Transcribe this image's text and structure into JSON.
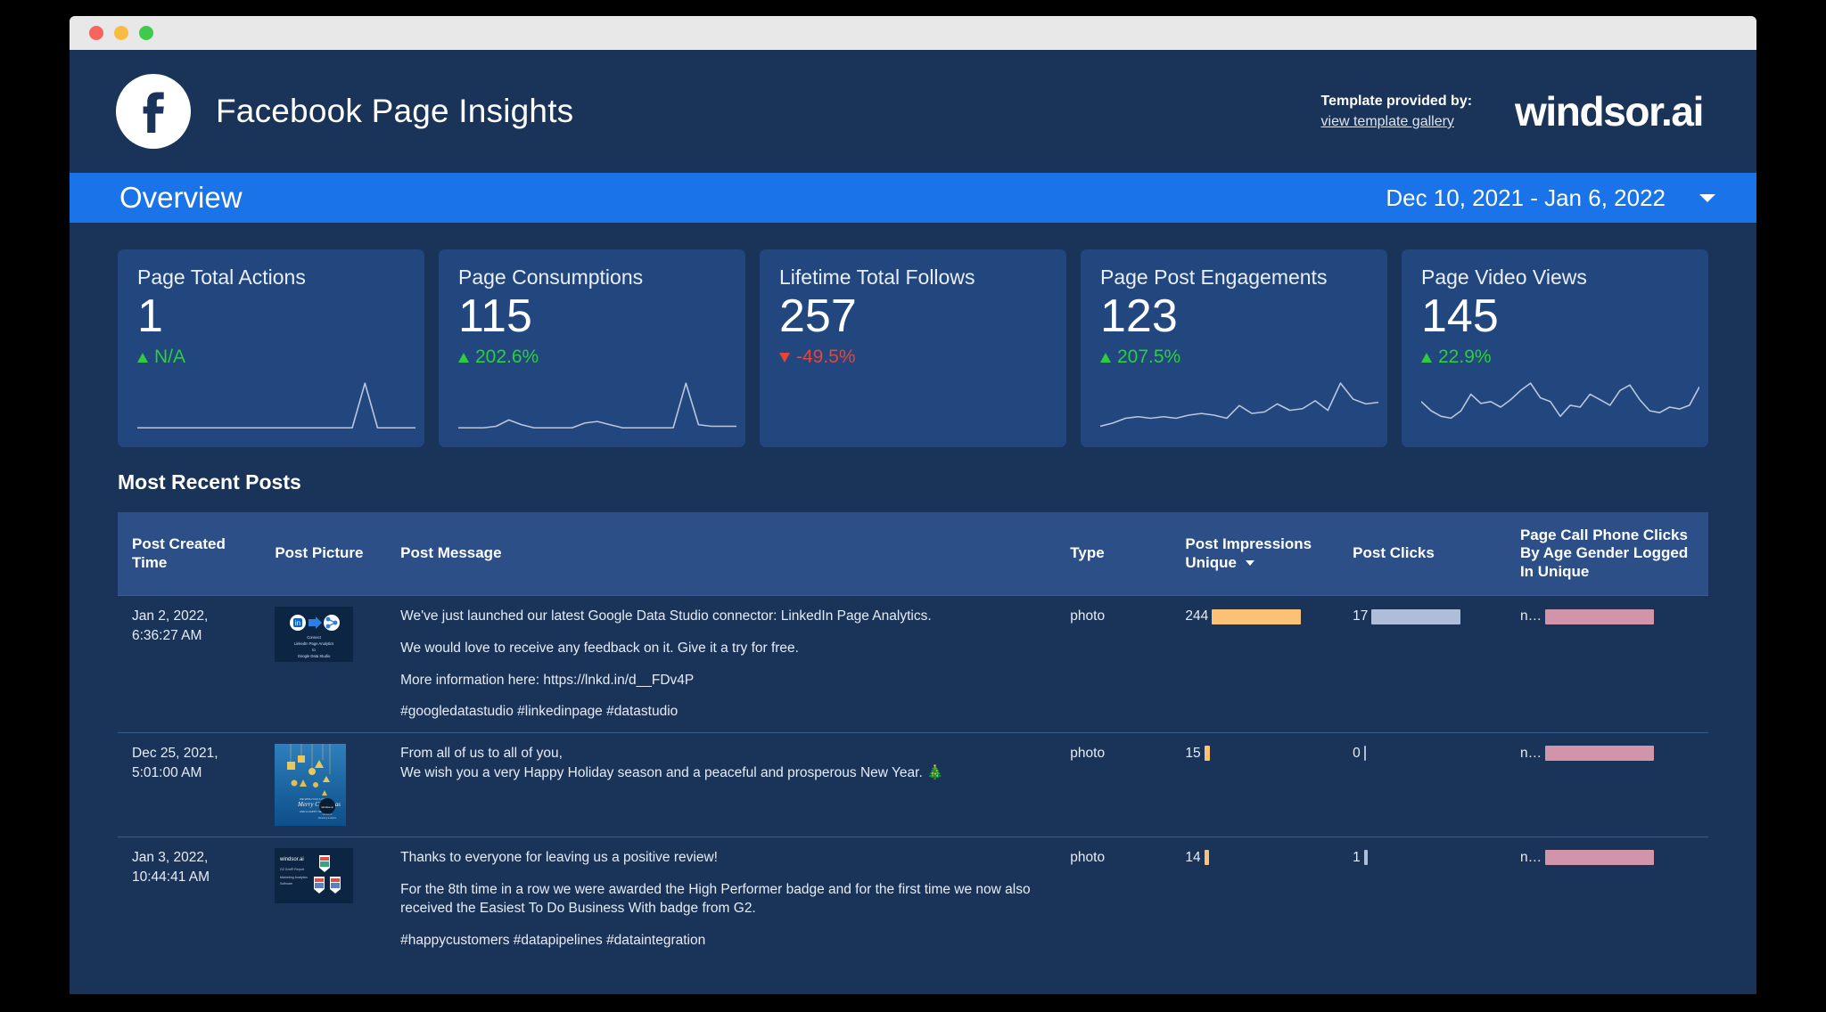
{
  "window": {
    "traffic_lights": [
      "close",
      "minimize",
      "maximize"
    ]
  },
  "header": {
    "logo_icon": "facebook-icon",
    "title": "Facebook Page Insights",
    "template_note_line1": "Template provided by:",
    "template_note_link": "view template gallery",
    "brand_logo_text": "windsor.ai"
  },
  "overview": {
    "title": "Overview",
    "date_range": "Dec 10, 2021 - Jan 6, 2022",
    "caret_icon": "chevron-down-icon",
    "bar_color": "#1a73e8"
  },
  "scorecards": [
    {
      "title": "Page Total Actions",
      "value": "1",
      "delta": "N/A",
      "direction": "up",
      "delta_color": "#2ecc40",
      "sparkline": [
        2,
        2,
        2,
        2,
        2,
        2,
        2,
        2,
        2,
        2,
        2,
        2,
        2,
        2,
        2,
        2,
        2,
        2,
        30,
        2,
        2,
        2,
        2
      ]
    },
    {
      "title": "Page Consumptions",
      "value": "115",
      "delta": "202.6%",
      "direction": "up",
      "delta_color": "#2ecc40",
      "sparkline": [
        2,
        2,
        2,
        3,
        7,
        4,
        2,
        2,
        2,
        2,
        5,
        6,
        4,
        2,
        2,
        2,
        2,
        2,
        30,
        4,
        3,
        3,
        3
      ]
    },
    {
      "title": "Lifetime Total Follows",
      "value": "257",
      "delta": "-49.5%",
      "direction": "down",
      "delta_color": "#e8443a",
      "sparkline": []
    },
    {
      "title": "Page Post Engagements",
      "value": "123",
      "delta": "207.5%",
      "direction": "up",
      "delta_color": "#2ecc40",
      "sparkline": [
        3,
        5,
        8,
        9,
        8,
        9,
        8,
        10,
        11,
        10,
        8,
        16,
        11,
        12,
        17,
        13,
        14,
        19,
        13,
        30,
        20,
        17,
        18
      ]
    },
    {
      "title": "Page Video Views",
      "value": "145",
      "delta": "22.9%",
      "direction": "up",
      "delta_color": "#2ecc40",
      "sparkline": [
        16,
        11,
        8,
        7,
        11,
        20,
        15,
        16,
        13,
        17,
        22,
        26,
        18,
        16,
        8,
        14,
        13,
        20,
        17,
        14,
        22,
        25,
        17,
        11,
        10,
        13,
        12,
        14,
        24
      ]
    }
  ],
  "posts_table": {
    "section_title": "Most Recent Posts",
    "columns": [
      {
        "label": "Post Created Time",
        "sorted": false
      },
      {
        "label": "Post Picture",
        "sorted": false
      },
      {
        "label": "Post Message",
        "sorted": false
      },
      {
        "label": "Type",
        "sorted": false
      },
      {
        "label": "Post Impressions Unique",
        "sorted": true,
        "sort_icon": "caret-down-icon"
      },
      {
        "label": "Post Clicks",
        "sorted": false
      },
      {
        "label": "Page Call Phone Clicks By Age Gender Logged In Unique",
        "sorted": false
      }
    ],
    "rows": [
      {
        "created_time": "Jan 2, 2022, 6:36:27 AM",
        "picture_alt": "linkedin-to-data-studio-thumbnail",
        "message_paragraphs": [
          "We've just launched our latest Google Data Studio connector: LinkedIn Page Analytics.",
          "We would love to receive any feedback on it. Give it a try for free.",
          "More information here: https://lnkd.in/d__FDv4P",
          "#googledatastudio #linkedinpage #datastudio"
        ],
        "type": "photo",
        "impressions_unique": "244",
        "impressions_bar_pct": 100,
        "post_clicks": "17",
        "clicks_bar_pct": 100,
        "phone_clicks": "n…",
        "phone_bar_pct": 100
      },
      {
        "created_time": "Dec 25, 2021, 5:01:00 AM",
        "picture_alt": "merry-christmas-thumbnail",
        "message_paragraphs": [
          "From all of us to all of you,\nWe wish you a very Happy Holiday season and a peaceful and prosperous New Year. 🎄"
        ],
        "type": "photo",
        "impressions_unique": "15",
        "impressions_bar_pct": 6,
        "post_clicks": "0",
        "clicks_bar_pct": 1,
        "phone_clicks": "n…",
        "phone_bar_pct": 100
      },
      {
        "created_time": "Jan 3, 2022, 10:44:41 AM",
        "picture_alt": "g2-badges-thumbnail",
        "message_paragraphs": [
          "Thanks to everyone for leaving us a positive review!",
          "For the 8th time in a row we were awarded the High Performer badge and for the first time we now also received the Easiest To Do Business With badge from G2.",
          "#happycustomers #datapipelines #dataintegration"
        ],
        "type": "photo",
        "impressions_unique": "14",
        "impressions_bar_pct": 5,
        "post_clicks": "1",
        "clicks_bar_pct": 4,
        "phone_clicks": "n…",
        "phone_bar_pct": 100
      }
    ]
  },
  "colors": {
    "page_background": "#1a3359",
    "card_background": "#22477f",
    "accent_blue": "#1a73e8",
    "header_row": "#2b4f86",
    "bar_orange": "#fbc177",
    "bar_blue": "#aebdd8",
    "bar_pink": "#d294a9",
    "positive": "#2ecc40",
    "negative": "#e8443a"
  }
}
